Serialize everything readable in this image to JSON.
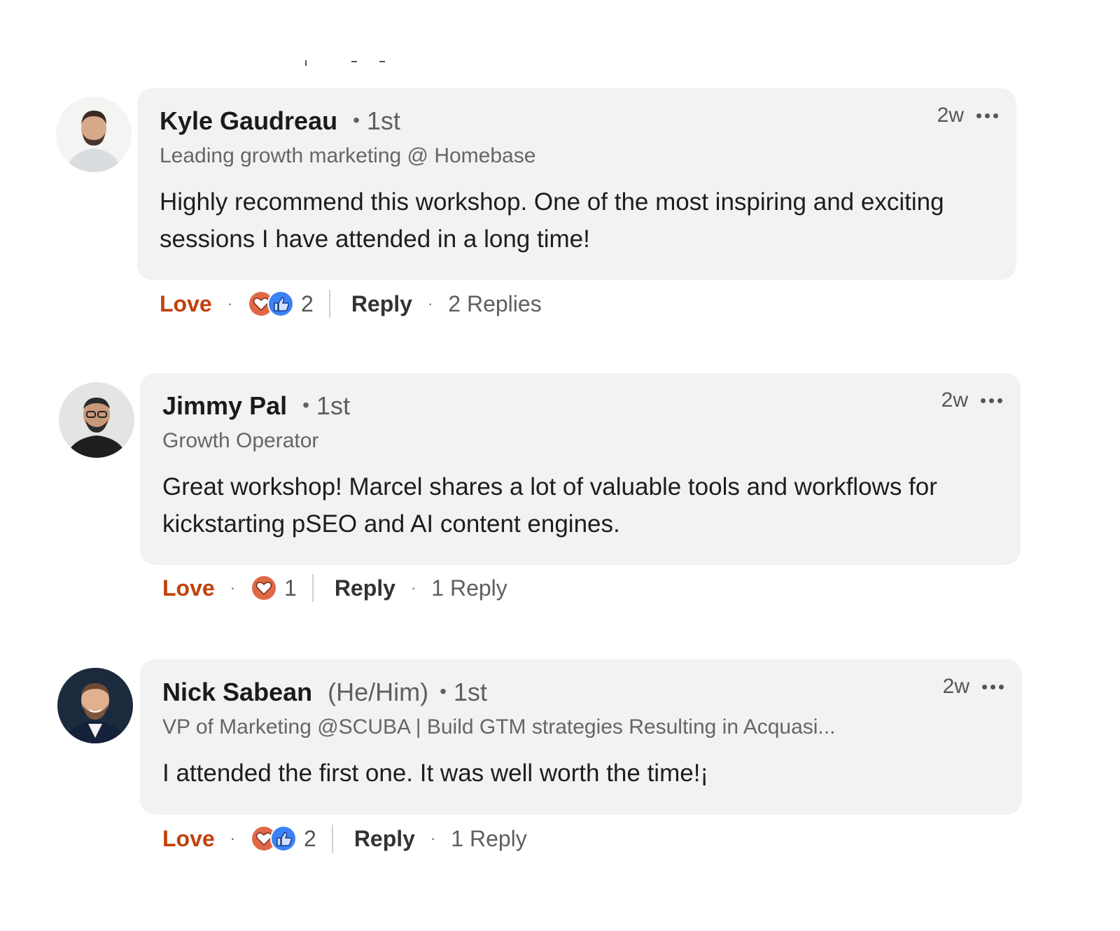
{
  "comments": [
    {
      "name": "Kyle Gaudreau",
      "pronouns": "",
      "degree": "1st",
      "headline": "Leading growth marketing @ Homebase",
      "text": "Highly recommend this workshop. One of the most inspiring and exciting sessions I have attended in a long time!",
      "time": "2w",
      "reaction_label": "Love",
      "reaction_icons": [
        "heart-icon",
        "thumbs-up-icon"
      ],
      "reaction_count": "2",
      "reply_label": "Reply",
      "replies_label": "2 Replies"
    },
    {
      "name": "Jimmy Pal",
      "pronouns": "",
      "degree": "1st",
      "headline": "Growth Operator",
      "text": "Great workshop! Marcel shares a lot of valuable tools and workflows for kickstarting pSEO and AI content engines.",
      "time": "2w",
      "reaction_label": "Love",
      "reaction_icons": [
        "heart-icon"
      ],
      "reaction_count": "1",
      "reply_label": "Reply",
      "replies_label": "1 Reply"
    },
    {
      "name": "Nick Sabean",
      "pronouns": "(He/Him)",
      "degree": "1st",
      "headline": "VP of Marketing @SCUBA | Build GTM strategies Resulting in Acquasi...",
      "text": "I attended the first one. It was well worth the time!¡",
      "time": "2w",
      "reaction_label": "Love",
      "reaction_icons": [
        "heart-icon",
        "thumbs-up-icon"
      ],
      "reaction_count": "2",
      "reply_label": "Reply",
      "replies_label": "1 Reply"
    }
  ],
  "colors": {
    "love": "#c2410c",
    "bubble": "#f2f2f2",
    "heart_badge": "#e06847",
    "like_badge": "#3b82f6"
  }
}
